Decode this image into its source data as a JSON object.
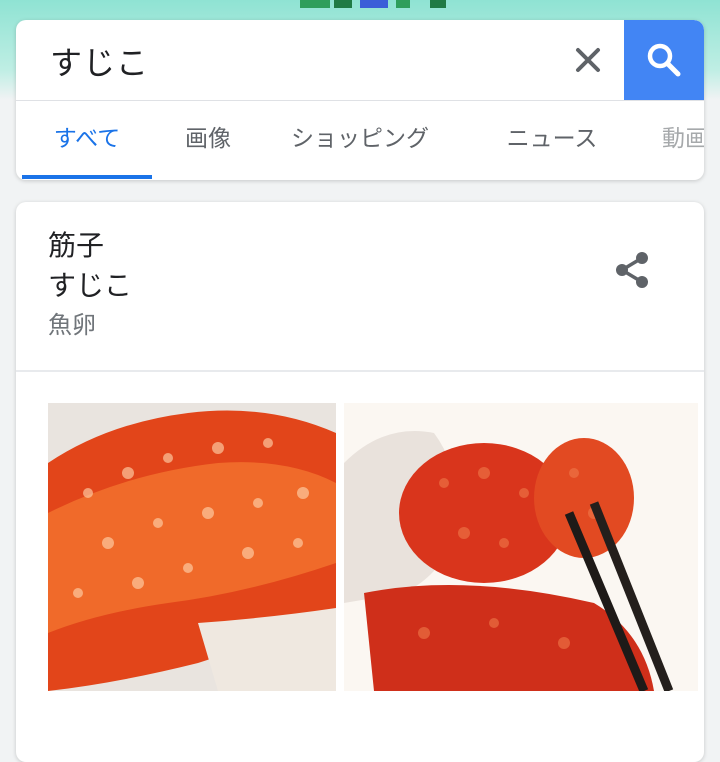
{
  "search": {
    "query": "すじこ",
    "clear_icon": "close-icon",
    "search_icon": "search-icon"
  },
  "tabs": [
    {
      "label": "すべて",
      "active": true
    },
    {
      "label": "画像",
      "active": false
    },
    {
      "label": "ショッピング",
      "active": false
    },
    {
      "label": "ニュース",
      "active": false
    },
    {
      "label": "動画",
      "active": false
    }
  ],
  "knowledge_panel": {
    "title": "筋子",
    "reading": "すじこ",
    "subtitle": "魚卵",
    "share_icon": "share-icon",
    "images": [
      "salmon-roe-photo",
      "roe-chopsticks-photo",
      "roe-photo-partial"
    ]
  },
  "colors": {
    "accent": "#1a73e8",
    "search_button": "#4285f4",
    "text_primary": "#202124",
    "text_secondary": "#70757a",
    "header_band": "#8fe3d3"
  }
}
